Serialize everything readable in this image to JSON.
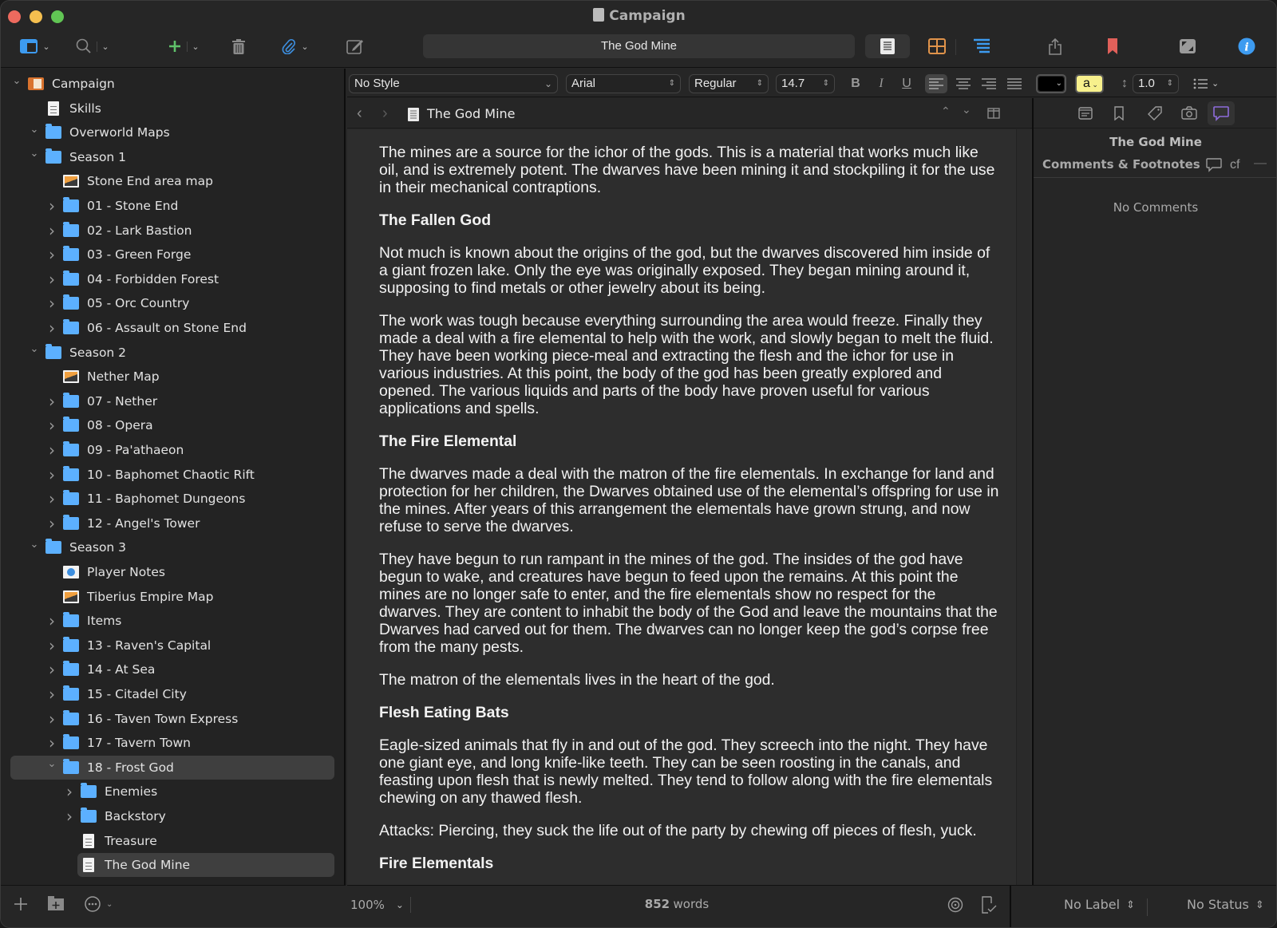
{
  "window": {
    "title": "Campaign"
  },
  "toolbar": {
    "document_title": "The God Mine",
    "colors": {
      "add": "#5fc16a",
      "attach": "#3d8fe0",
      "bookmark": "#e0605a",
      "info": "#3d9bf0",
      "outline": "#3d9bf0",
      "corkboard": "#e0934a"
    }
  },
  "binder": {
    "items": [
      {
        "label": "Campaign",
        "icon": "project-icon",
        "level": 0,
        "arrow": "expanded"
      },
      {
        "label": "Skills",
        "icon": "document-icon",
        "level": 1,
        "arrow": "none"
      },
      {
        "label": "Overworld Maps",
        "icon": "folder-icon",
        "level": 1,
        "arrow": "expanded"
      },
      {
        "label": "Season 1",
        "icon": "folder-icon",
        "level": 1,
        "arrow": "expanded"
      },
      {
        "label": "Stone End area map",
        "icon": "image-icon",
        "level": 2,
        "arrow": "none"
      },
      {
        "label": "01 - Stone End",
        "icon": "folder-icon",
        "level": 2,
        "arrow": "collapsed"
      },
      {
        "label": "02 - Lark Bastion",
        "icon": "folder-icon",
        "level": 2,
        "arrow": "collapsed"
      },
      {
        "label": "03 - Green Forge",
        "icon": "folder-icon",
        "level": 2,
        "arrow": "collapsed"
      },
      {
        "label": "04 - Forbidden Forest",
        "icon": "folder-icon",
        "level": 2,
        "arrow": "collapsed"
      },
      {
        "label": "05 - Orc Country",
        "icon": "folder-icon",
        "level": 2,
        "arrow": "collapsed"
      },
      {
        "label": "06 - Assault on Stone End",
        "icon": "folder-icon",
        "level": 2,
        "arrow": "collapsed"
      },
      {
        "label": "Season 2",
        "icon": "folder-icon",
        "level": 1,
        "arrow": "expanded"
      },
      {
        "label": "Nether Map",
        "icon": "image-icon",
        "level": 2,
        "arrow": "none"
      },
      {
        "label": "07 - Nether",
        "icon": "folder-icon",
        "level": 2,
        "arrow": "collapsed"
      },
      {
        "label": "08 - Opera",
        "icon": "folder-icon",
        "level": 2,
        "arrow": "collapsed"
      },
      {
        "label": "09 - Pa'athaeon",
        "icon": "folder-icon",
        "level": 2,
        "arrow": "collapsed"
      },
      {
        "label": "10 - Baphomet Chaotic Rift",
        "icon": "folder-icon",
        "level": 2,
        "arrow": "collapsed"
      },
      {
        "label": "11 - Baphomet Dungeons",
        "icon": "folder-icon",
        "level": 2,
        "arrow": "collapsed"
      },
      {
        "label": "12 - Angel's Tower",
        "icon": "folder-icon",
        "level": 2,
        "arrow": "collapsed"
      },
      {
        "label": "Season 3",
        "icon": "folder-icon",
        "level": 1,
        "arrow": "expanded"
      },
      {
        "label": "Player Notes",
        "icon": "web-page-icon",
        "level": 2,
        "arrow": "none"
      },
      {
        "label": "Tiberius Empire Map",
        "icon": "image-icon",
        "level": 2,
        "arrow": "none"
      },
      {
        "label": "Items",
        "icon": "folder-icon",
        "level": 2,
        "arrow": "collapsed"
      },
      {
        "label": "13 - Raven's Capital",
        "icon": "folder-icon",
        "level": 2,
        "arrow": "collapsed"
      },
      {
        "label": "14 - At Sea",
        "icon": "folder-icon",
        "level": 2,
        "arrow": "collapsed"
      },
      {
        "label": "15 - Citadel City",
        "icon": "folder-icon",
        "level": 2,
        "arrow": "collapsed"
      },
      {
        "label": "16 - Taven Town Express",
        "icon": "folder-icon",
        "level": 2,
        "arrow": "collapsed"
      },
      {
        "label": "17 - Tavern Town",
        "icon": "folder-icon",
        "level": 2,
        "arrow": "collapsed"
      },
      {
        "label": "18 - Frost God",
        "icon": "folder-icon",
        "level": 2,
        "arrow": "expanded",
        "selected": "group"
      },
      {
        "label": "Enemies",
        "icon": "folder-icon",
        "level": 3,
        "arrow": "collapsed"
      },
      {
        "label": "Backstory",
        "icon": "folder-icon",
        "level": 3,
        "arrow": "collapsed"
      },
      {
        "label": "Treasure",
        "icon": "document-icon",
        "level": 3,
        "arrow": "none"
      },
      {
        "label": "The God Mine",
        "icon": "document-icon",
        "level": 3,
        "arrow": "none",
        "selected": "current"
      }
    ]
  },
  "format_bar": {
    "style": "No Style",
    "font": "Arial",
    "weight": "Regular",
    "size": "14.7",
    "bold": "B",
    "italic": "I",
    "underline": "U",
    "text_color": "#000000",
    "highlight_label": "a",
    "highlight_color": "#f7f08c",
    "line_spacing": "1.0"
  },
  "editor": {
    "header_title": "The God Mine",
    "blocks": [
      {
        "type": "p",
        "text": "The mines are a source for the ichor of the gods. This is a material that works much like oil, and is extremely potent. The dwarves have been mining it and stockpiling it for the use in their mechanical contraptions."
      },
      {
        "type": "h",
        "text": "The Fallen God"
      },
      {
        "type": "p",
        "text": "Not much is known about the origins of the god, but the dwarves discovered him inside of a giant frozen lake. Only the eye was originally exposed. They began mining around it, supposing to find metals or other jewelry about its being."
      },
      {
        "type": "p",
        "text": "The work was tough because everything surrounding the area would freeze. Finally they made a deal with a fire elemental to help with the work, and slowly began to melt the fluid. They have been working piece-meal and extracting the flesh and the ichor for use in various industries. At this point, the body of the god has been greatly explored and opened. The various liquids and parts of the body have proven useful for various applications and spells."
      },
      {
        "type": "h",
        "text": "The Fire Elemental"
      },
      {
        "type": "p",
        "text": "The dwarves made a deal with the matron of the fire elementals. In exchange for land and protection for her children, the Dwarves obtained use of the elemental’s offspring for use in the mines. After years of this arrangement the elementals have grown strung, and now refuse to serve the dwarves."
      },
      {
        "type": "p",
        "text": "They have begun to run rampant in the mines of the god. The insides of the god have begun to wake, and creatures have begun to feed upon the remains. At this point the mines are no longer safe to enter, and the fire elementals show no respect for the dwarves. They are content to inhabit the body of the God and leave the mountains that the Dwarves had carved out for them. The dwarves can no longer keep the god’s corpse free from the many pests."
      },
      {
        "type": "p",
        "text": "The matron of the elementals lives in the heart of the god."
      },
      {
        "type": "h",
        "text": "Flesh Eating Bats"
      },
      {
        "type": "p",
        "text": "Eagle-sized animals that fly in and out of the god. They screech into the night. They have one giant eye, and long knife-like teeth. They can be seen roosting in the canals, and feasting upon flesh that is newly melted. They tend to follow along with the fire elementals chewing on any thawed flesh."
      },
      {
        "type": "p",
        "text": "Attacks: Piercing, they suck the life out of the party by chewing off pieces of flesh, yuck."
      },
      {
        "type": "h",
        "text": "Fire Elementals"
      }
    ]
  },
  "inspector": {
    "title": "The God Mine",
    "section": "Comments & Footnotes",
    "footnote_label": "cf",
    "empty_text": "No Comments",
    "active_tab_color": "#8e6cdb"
  },
  "status": {
    "zoom": "100%",
    "word_count": "852",
    "word_label": "words",
    "label": "No Label",
    "status": "No Status"
  }
}
